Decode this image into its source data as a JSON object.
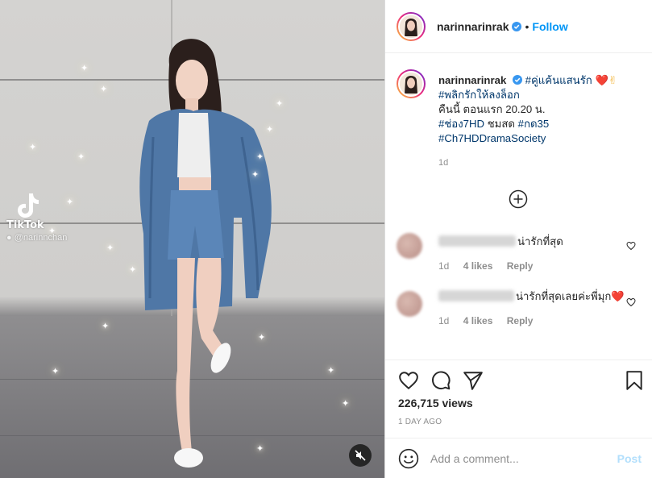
{
  "post": {
    "username": "narinnarinrak",
    "follow_label": "Follow",
    "dot": "•",
    "caption": {
      "username": "narinnarinrak",
      "hashtag_1": "#คู่แค้นแสนรัก",
      "hashtag_2": "#พลิกรักให้ลงล็อก",
      "line_3": "คืนนี้ ตอนแรก 20.20 น.",
      "hashtag_3": "#ช่อง7HD",
      "text_ch": "ชมสด",
      "hashtag_4": "#กด35",
      "hashtag_5": "#Ch7HDDramaSociety",
      "time": "1d"
    },
    "comments": [
      {
        "text": "น่ารักที่สุด",
        "time": "1d",
        "likes": "4 likes",
        "reply": "Reply"
      },
      {
        "text": "น่ารักที่สุดเลยค่ะพี่มุก",
        "time": "1d",
        "likes": "4 likes",
        "reply": "Reply"
      }
    ],
    "views": "226,715 views",
    "posted": "1 DAY AGO",
    "comment_placeholder": "Add a comment...",
    "post_label": "Post"
  },
  "media": {
    "watermark_name": "TikTok",
    "watermark_handle": "@narinnchan"
  },
  "colors": {
    "accent": "#0095f6",
    "heart": "#ed4956",
    "verified": "#3897f0",
    "hashtag": "#00376b"
  },
  "icons": [
    "verified-badge-icon",
    "heart-icon",
    "comment-icon",
    "share-icon",
    "bookmark-icon",
    "emoji-icon",
    "plus-circle-icon",
    "mute-icon",
    "tiktok-logo-icon"
  ]
}
